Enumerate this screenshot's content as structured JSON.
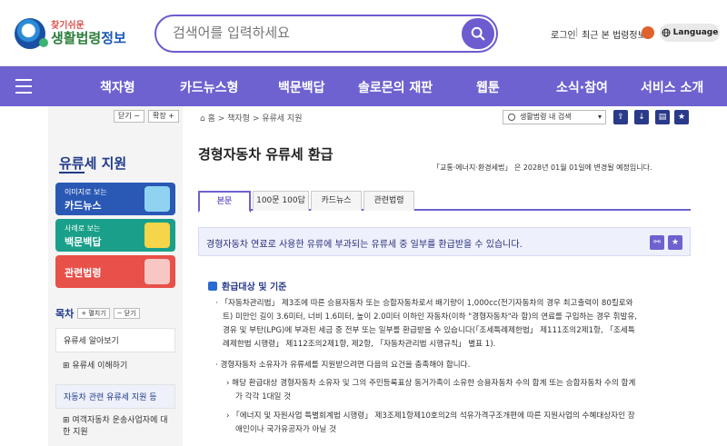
{
  "header": {
    "logo_small": "찾기쉬운",
    "logo_big_a": "생활법령",
    "logo_big_b": "정보",
    "search_placeholder": "검색어를 입력하세요",
    "login": "로그인",
    "sep": "|",
    "recent": "최근 본 법령정보",
    "language": "Language"
  },
  "nav": {
    "items": [
      "책자형",
      "카드뉴스형",
      "백문백답",
      "솔로몬의 재판",
      "웹툰",
      "소식·참여",
      "서비스 소개"
    ]
  },
  "sidebar": {
    "collapse": "닫기 −",
    "expand": "확장 +",
    "title": "유류세 지원",
    "cards": [
      {
        "sub": "이미지로 보는",
        "main": "카드뉴스",
        "color": "#2a58b5"
      },
      {
        "sub": "사례로 보는",
        "main": "백문백답",
        "color": "#1aa08a"
      },
      {
        "sub": "",
        "main": "관련법령",
        "color": "#e8504a"
      }
    ],
    "toc_label": "목차",
    "toc_expand": "+ 펼치기",
    "toc_collapse": "− 닫기",
    "toc_items": [
      "유류세 알아보기",
      "⊞ 유류세 이해하기",
      "자동차 관련 유류세 지원 등",
      "⊞ 여객자동차 운송사업자에 대한 지원"
    ]
  },
  "main": {
    "breadcrumb": "⌂ 홈 > 책자형 > 유류세 지원",
    "search_scope": "생활법령 내 검색",
    "title": "경형자동차 유류세 환급",
    "notice": "「교통·에너지·환경세법」 은 2028년 01월 01일에 변경될 예정입니다.",
    "tabs": [
      "본문",
      "100문 100답",
      "카드뉴스",
      "관련법령"
    ],
    "summary": "경형자동차 연료로 사용한 유류에 부과되는 유류세 중 일부를 환급받을 수 있습니다.",
    "section_title": "환급대상 및 기준",
    "p1_a": "· 「자동차관리법」 제3조에 따른 승용자동차 또는 승합자동차로서 배기량이 1,000cc(전기자동차의 경우 최고출력이 80킬로와",
    "p1_b": "트) 미만인 길이 3.6미터, 너비 1.6미터, 높이 2.0미터 이하인 자동차(이하 \"경형자동차\"라 함)의 연료를 구입하는 경우 휘발유,",
    "p1_c": "경유 및 부탄(LPG)에 부과된 세금 중 전부 또는 일부를 환급받을 수 있습니다(「조세특례제한법」 제111조의2제1항, 「조세특",
    "p1_d": "례제한법 시행령」 제112조의2제1항, 제2항, 「자동차관리법 시행규칙」 별표 1).",
    "p2": "· 경형자동차 소유자가 유류세를 지원받으려면 다음의 요건을 충족해야 합니다.",
    "p3_a": "› 해당 환급대상 경형자동차 소유자 및 그의 주민등록표상 동거가족이 소유한 승용자동차 수의 합계 또는 승합자동차 수의 합계",
    "p3_b": "가 각각 1대일 것",
    "p4_a": "› 「에너지 및 자원사업 특별회계법 시행령」 제3조제1항제10호의2의 석유가격구조개편에 따른 지원사업의 수혜대상자인 장",
    "p4_b": "애인이나 국가유공자가 아닐 것"
  }
}
